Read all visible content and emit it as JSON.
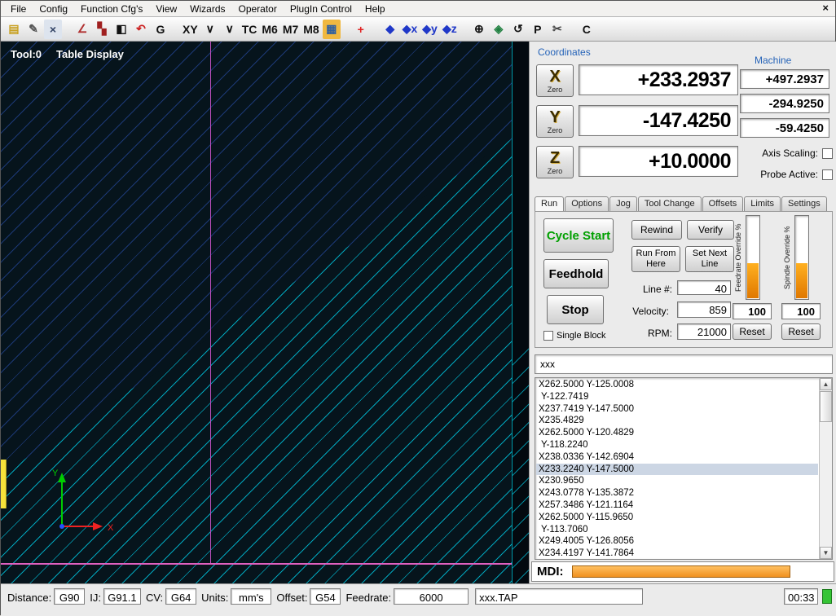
{
  "menu": {
    "items": [
      "File",
      "Config",
      "Function Cfg's",
      "View",
      "Wizards",
      "Operator",
      "PlugIn Control",
      "Help"
    ],
    "close_glyph": "×"
  },
  "toolbar": {
    "items": [
      {
        "name": "new-file-icon",
        "glyph": "▤",
        "color": "#c8a020"
      },
      {
        "name": "edit-file-icon",
        "glyph": "✎",
        "color": "#555555"
      },
      {
        "name": "close-file-icon",
        "glyph": "×",
        "color": "#334466",
        "bg": "#dde4ee"
      },
      {
        "name": "spacer"
      },
      {
        "name": "probe-tool-icon",
        "glyph": "∠",
        "color": "#b03030"
      },
      {
        "name": "display-mode-icon",
        "glyph": "▚",
        "color": "#a02020"
      },
      {
        "name": "contrast-icon",
        "glyph": "◧",
        "color": "#111111"
      },
      {
        "name": "undo-icon",
        "glyph": "↶",
        "color": "#cc2020"
      },
      {
        "name": "gcode-icon",
        "glyph": "G",
        "color": "#111111"
      },
      {
        "name": "spacer"
      },
      {
        "name": "xy-plane-icon",
        "glyph": "XY",
        "color": "#111111"
      },
      {
        "name": "z-lower-icon",
        "glyph": "∨",
        "color": "#111111"
      },
      {
        "name": "z-raise-icon",
        "glyph": "∨",
        "color": "#111111"
      },
      {
        "name": "tool-change-icon",
        "glyph": "TC",
        "color": "#111111"
      },
      {
        "name": "m6-icon",
        "glyph": "M6",
        "color": "#111111"
      },
      {
        "name": "m7-icon",
        "glyph": "M7",
        "color": "#111111"
      },
      {
        "name": "m8-icon",
        "glyph": "M8",
        "color": "#111111"
      },
      {
        "name": "tool-table-icon",
        "glyph": "▦",
        "color": "#3060a0",
        "bg": "#f0b840"
      },
      {
        "name": "spacer"
      },
      {
        "name": "goto-zero-icon",
        "glyph": "+",
        "color": "#e02020"
      },
      {
        "name": "spacer"
      },
      {
        "name": "ref-all-home-icon",
        "glyph": "◆",
        "color": "#2038c8"
      },
      {
        "name": "zero-x-icon",
        "glyph": "◆x",
        "color": "#2038c8"
      },
      {
        "name": "zero-y-icon",
        "glyph": "◆y",
        "color": "#2038c8"
      },
      {
        "name": "zero-z-icon",
        "glyph": "◆z",
        "color": "#2038c8"
      },
      {
        "name": "spacer"
      },
      {
        "name": "machine-coords-icon",
        "glyph": "⊕",
        "color": "#111111"
      },
      {
        "name": "safety-shield-icon",
        "glyph": "◈",
        "color": "#208040"
      },
      {
        "name": "rotate-icon",
        "glyph": "↺",
        "color": "#111111"
      },
      {
        "name": "park-icon",
        "glyph": "P",
        "color": "#111111"
      },
      {
        "name": "cut-icon",
        "glyph": "✂",
        "color": "#444444"
      },
      {
        "name": "spacer"
      },
      {
        "name": "regen-toolpath-icon",
        "glyph": "C",
        "color": "#111111"
      }
    ]
  },
  "display": {
    "tool_label": "Tool:0",
    "view_label": "Table Display",
    "axis_x_label": "X",
    "axis_y_label": "Y"
  },
  "coordinates": {
    "title": "Coordinates",
    "machine_title": "Machine",
    "axes": [
      {
        "letter": "X",
        "zero": "Zero",
        "value": "+233.2937",
        "machine": "+497.2937"
      },
      {
        "letter": "Y",
        "zero": "Zero",
        "value": "-147.4250",
        "machine": "-294.9250"
      },
      {
        "letter": "Z",
        "zero": "Zero",
        "value": "+10.0000",
        "machine": "-59.4250"
      }
    ],
    "axis_scaling_label": "Axis Scaling:",
    "probe_active_label": "Probe Active:"
  },
  "tabs": {
    "items": [
      "Run",
      "Options",
      "Jog",
      "Tool Change",
      "Offsets",
      "Limits",
      "Settings"
    ],
    "active": "Run"
  },
  "run": {
    "cycle_start": "Cycle Start",
    "rewind": "Rewind",
    "verify": "Verify",
    "feedhold": "Feedhold",
    "run_from_here": "Run From Here",
    "set_next_line": "Set Next Line",
    "stop": "Stop",
    "single_block": "Single Block",
    "line_label": "Line #:",
    "line_value": "40",
    "velocity_label": "Velocity:",
    "velocity_value": "859",
    "rpm_label": "RPM:",
    "rpm_value": "21000",
    "fro_label": "Feedrate Override %",
    "sro_label": "Spindle Override %",
    "fro_value": "100",
    "sro_value": "100",
    "fro_percent": 42,
    "sro_percent": 42,
    "fro_reset": "Reset",
    "sro_reset": "Reset"
  },
  "gcode": {
    "filename_text": "xxx",
    "lines": [
      "X262.5000 Y-125.0008",
      " Y-122.7419",
      "X237.7419 Y-147.5000",
      "X235.4829",
      "X262.5000 Y-120.4829",
      " Y-118.2240",
      "X238.0336 Y-142.6904",
      "X233.2240 Y-147.5000",
      "X230.9650",
      "X243.0778 Y-135.3872",
      "X257.3486 Y-121.1164",
      "X262.5000 Y-115.9650",
      " Y-113.7060",
      "X249.4005 Y-126.8056",
      "X234.4197 Y-141.7864"
    ],
    "highlighted_index": 7,
    "scroll_up_glyph": "▲",
    "scroll_down_glyph": "▼"
  },
  "mdi": {
    "label": "MDI:",
    "value": ""
  },
  "status": {
    "items": [
      {
        "label": "Distance:",
        "value": "G90"
      },
      {
        "label": "IJ:",
        "value": "G91.1"
      },
      {
        "label": "CV:",
        "value": "G64"
      },
      {
        "label": "Units:",
        "value": "mm's"
      },
      {
        "label": "Offset:",
        "value": "G54"
      },
      {
        "label": "Feedrate:",
        "value": "6000"
      }
    ],
    "file": "xxx.TAP",
    "time": "00:33"
  }
}
